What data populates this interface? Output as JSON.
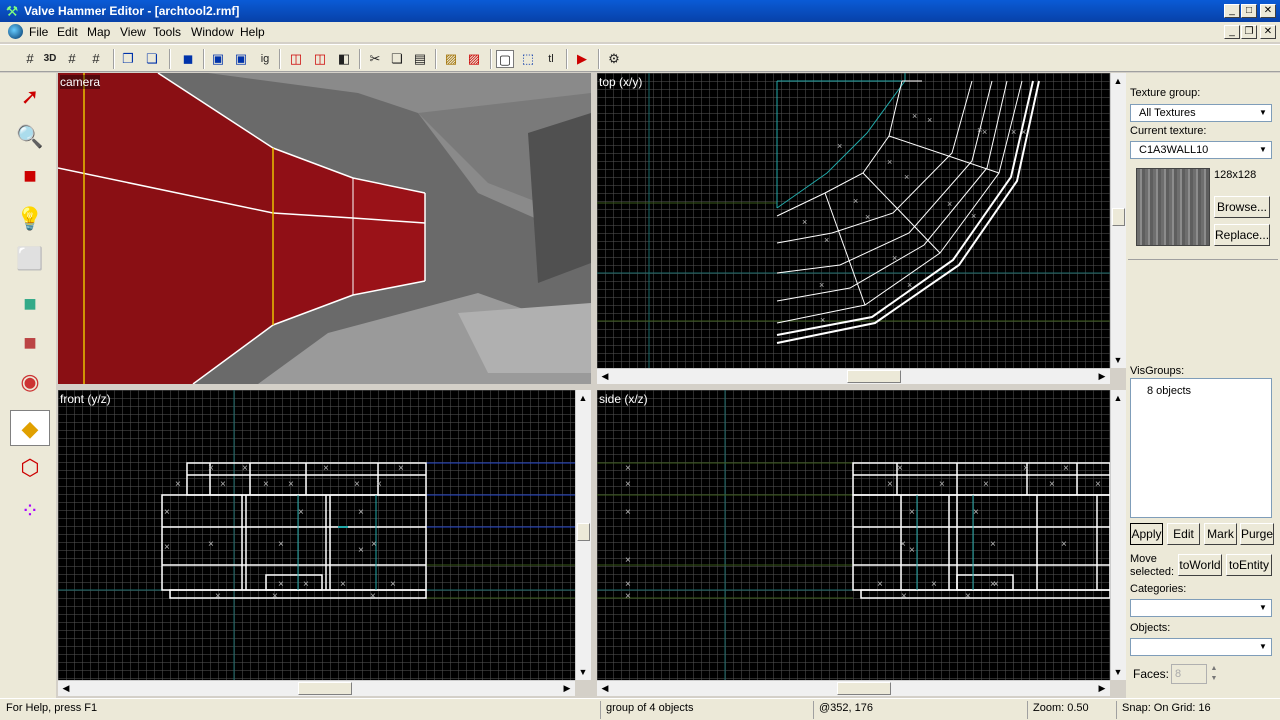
{
  "window": {
    "title": "Valve Hammer Editor - [archtool2.rmf]"
  },
  "menu": [
    "File",
    "Edit",
    "Map",
    "View",
    "Tools",
    "Window",
    "Help"
  ],
  "toolbar_icons": [
    "grid-icon",
    "3d-grid-icon",
    "grid-smaller-icon",
    "grid-larger-icon",
    "group-icon",
    "ungroup-icon",
    "carve-icon",
    "hollow-icon",
    "toggle-texture-icon",
    "texture-lock-icon",
    "ignore-groups-icon",
    "hide-icon",
    "show-icon",
    "show-all-icon",
    "cut-icon",
    "copy-icon",
    "paste-icon",
    "hatch-icon",
    "hatch-red-icon",
    "select-box-icon",
    "select-cursor-icon",
    "text-icon",
    "run-map-icon",
    "options-icon"
  ],
  "toolbar_text": {
    "ig": "ig",
    "tl": "tl"
  },
  "left_tools": [
    "selection-tool-icon",
    "magnify-tool-icon",
    "camera-tool-icon",
    "entity-tool-icon",
    "block-tool-icon",
    "texture-application-icon",
    "apply-texture-icon",
    "decal-tool-icon",
    "clipping-tool-icon",
    "vertex-tool-icon",
    "path-tool-icon"
  ],
  "viewports": {
    "camera": "camera",
    "top": "top (x/y)",
    "front": "front (y/z)",
    "side": "side (x/z)"
  },
  "texture_panel": {
    "texture_group_label": "Texture group:",
    "texture_group_value": "All Textures",
    "current_texture_label": "Current texture:",
    "current_texture_value": "C1A3WALL10",
    "texture_size": "128x128",
    "browse_label": "Browse...",
    "replace_label": "Replace..."
  },
  "visgroups": {
    "label": "VisGroups:",
    "items": [
      "8 objects"
    ],
    "apply": "Apply",
    "edit": "Edit",
    "mark": "Mark",
    "purge": "Purge"
  },
  "move_selected": {
    "label_line1": "Move",
    "label_line2": "selected:",
    "to_world": "toWorld",
    "to_entity": "toEntity"
  },
  "categories": {
    "label": "Categories:",
    "value": ""
  },
  "objects": {
    "label": "Objects:",
    "value": ""
  },
  "faces": {
    "label": "Faces:",
    "value": "8"
  },
  "status": {
    "help": "For Help, press F1",
    "selection": "group of 4 objects",
    "coords": "@352, 176",
    "zoom": "Zoom: 0.50",
    "snap": "Snap: On Grid: 16"
  },
  "colors": {
    "title_bar": "#0a5bd6",
    "wall_red": "#8a0f14",
    "grid_axis": "#1a6a6a",
    "selection_white": "#ffffff"
  }
}
